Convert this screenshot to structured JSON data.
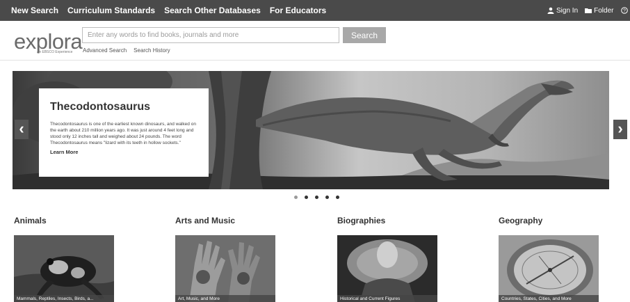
{
  "topnav": {
    "links": [
      "New Search",
      "Curriculum Standards",
      "Search Other Databases",
      "For Educators"
    ],
    "sign_in": "Sign In",
    "folder": "Folder",
    "help": "He"
  },
  "header": {
    "logo_word": "explora",
    "logo_tagline": "An EBSCO Experience",
    "search_placeholder": "Enter any words to find books, journals and more",
    "search_button": "Search",
    "advanced_search": "Advanced Search",
    "search_history": "Search History"
  },
  "hero": {
    "title": "Thecodontosaurus",
    "text": "Thecodontosaurus is one of the earliest known dinosaurs, and walked on the earth about 210 million years ago. It was just around 4 feet long and stood only 12 inches tall and weighed about 24 pounds. The word Thecodontosaurus means \"lizard with its teeth in hollow sockets.\"",
    "learn_more": "Learn More",
    "prev_glyph": "‹",
    "next_glyph": "›",
    "slide_count": 5,
    "active_slide": 2
  },
  "categories": [
    {
      "title": "Animals",
      "caption": "Mammals, Reptiles, Insects, Birds, a..."
    },
    {
      "title": "Arts and Music",
      "caption": "Art, Music, and More"
    },
    {
      "title": "Biographies",
      "caption": "Historical and Current Figures"
    },
    {
      "title": "Geography",
      "caption": "Countries, States, Cities, and More"
    }
  ],
  "icons": {
    "sign_in": "user-icon",
    "folder": "folder-icon",
    "help": "help-icon",
    "prev": "chevron-left-icon",
    "next": "chevron-right-icon"
  },
  "colors": {
    "nav_bg": "#4a4a4a",
    "search_button_bg": "#a8a8a8",
    "arrow_bg": "#555555"
  }
}
